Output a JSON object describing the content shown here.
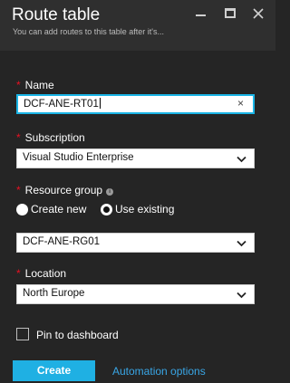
{
  "header": {
    "title": "Route table",
    "subtitle": "You can add routes to this table after it's..."
  },
  "form": {
    "required_marker": "*",
    "name": {
      "label": "Name",
      "value": "DCF-ANE-RT01",
      "clear_icon": "×"
    },
    "subscription": {
      "label": "Subscription",
      "value": "Visual Studio Enterprise"
    },
    "resource_group": {
      "label": "Resource group",
      "info_icon": "i",
      "options": [
        {
          "label": "Create new",
          "checked": false
        },
        {
          "label": "Use existing",
          "checked": true
        }
      ],
      "value": "DCF-ANE-RG01"
    },
    "location": {
      "label": "Location",
      "value": "North Europe"
    },
    "pin_to_dashboard": {
      "label": "Pin to dashboard",
      "checked": false
    }
  },
  "footer": {
    "create_label": "Create",
    "automation_label": "Automation options"
  },
  "colors": {
    "background": "#252525",
    "header_bg": "#2f2f2f",
    "accent": "#1fb0e3",
    "link": "#39a6e6",
    "required": "#e81123"
  }
}
